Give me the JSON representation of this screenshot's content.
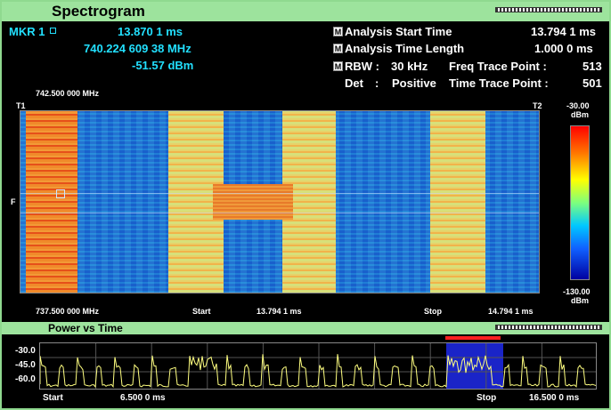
{
  "title": "Spectrogram",
  "marker": {
    "label": "MKR 1",
    "time": "13.870 1  ms",
    "freq": "740.224 609 38  MHz",
    "level": "-51.57  dBm"
  },
  "settings": {
    "analysis_start_label": "Analysis Start Time",
    "analysis_start_value": "13.794 1 ms",
    "analysis_length_label": "Analysis Time Length",
    "analysis_length_value": "1.000 0 ms",
    "rbw_label": "RBW :",
    "rbw_value": "30 kHz",
    "freq_trace_label": "Freq Trace Point :",
    "freq_trace_value": "513",
    "det_label": "Det",
    "det_colon": ":",
    "det_value": "Positive",
    "time_trace_label": "Time Trace Point :",
    "time_trace_value": "501",
    "m_icon": "M"
  },
  "spectrogram": {
    "top_freq": "742.500 000 MHz",
    "bottom_freq": "737.500 000 MHz",
    "t1": "T1",
    "t2": "T2",
    "f": "F",
    "start_label": "Start",
    "start_value": "13.794 1  ms",
    "stop_label": "Stop",
    "stop_value": "14.794 1  ms"
  },
  "colorbar": {
    "top": "-30.00",
    "top_unit": "dBm",
    "bottom": "-130.00",
    "bottom_unit": "dBm"
  },
  "pvt": {
    "title": "Power vs Time",
    "y_ticks": [
      "-30.0",
      "-45.0",
      "-60.0"
    ],
    "start_label": "Start",
    "start_value": "6.500 0  ms",
    "stop_label": "Stop",
    "stop_value": "16.500 0  ms"
  },
  "colors": {
    "frame": "#8fd98f",
    "marker_text": "#22e0ff",
    "trace": "#ffff80",
    "selection": "#1a24c8",
    "selection_bar": "#ff2020"
  }
}
